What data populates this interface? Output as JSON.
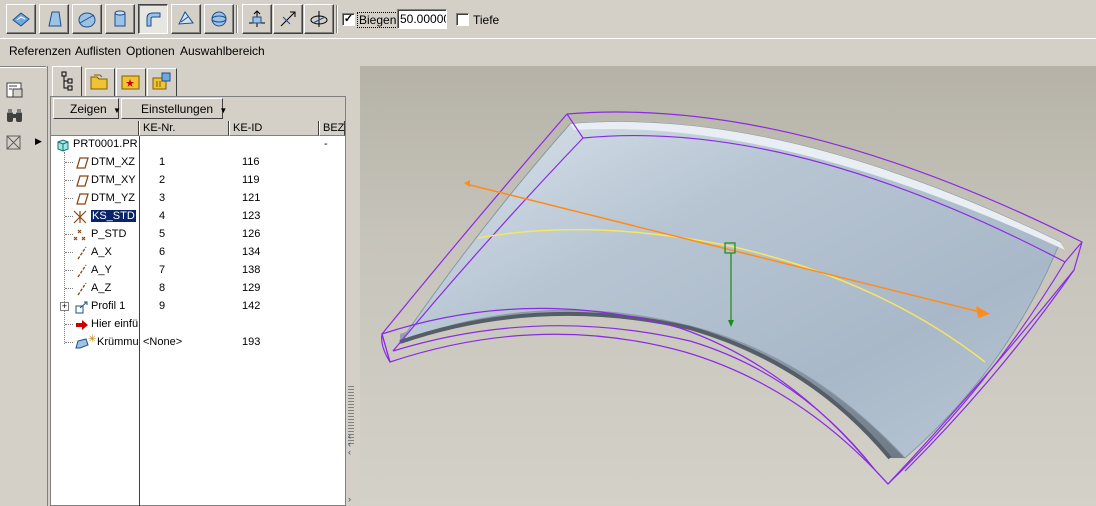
{
  "toolbar": {
    "buttons": [
      {
        "name": "surface-icon"
      },
      {
        "name": "solid-icon"
      },
      {
        "name": "thicken-icon"
      },
      {
        "name": "cylinder-icon"
      },
      {
        "name": "sweep-icon",
        "pressed": true
      },
      {
        "name": "warp-icon"
      },
      {
        "name": "sphere-icon"
      }
    ],
    "buttons2": [
      {
        "name": "move-axis-icon"
      },
      {
        "name": "diagonal-icon"
      },
      {
        "name": "rotate-axis-icon"
      }
    ],
    "biegen_checked": true,
    "biegen_label": "Biegen",
    "biegen_value": "50.00000",
    "tiefe_checked": false,
    "tiefe_label": "Tiefe"
  },
  "menu": [
    "Referenzen",
    "Auflisten",
    "Optionen",
    "Auswahlbereich"
  ],
  "tree": {
    "zeigen_label": "Zeigen",
    "einstellungen_label": "Einstellungen",
    "columns": [
      "KE-Nr.",
      "KE-ID",
      "BEZ"
    ],
    "root": {
      "name": "PRT0001.PR",
      "bez": "-"
    },
    "items": [
      {
        "name": "DTM_XZ",
        "nr": "1",
        "id": "116",
        "icon": "datum-plane-icon"
      },
      {
        "name": "DTM_XY",
        "nr": "2",
        "id": "119",
        "icon": "datum-plane-icon"
      },
      {
        "name": "DTM_YZ",
        "nr": "3",
        "id": "121",
        "icon": "datum-plane-icon"
      },
      {
        "name": "KS_STD",
        "nr": "4",
        "id": "123",
        "icon": "coordinate-system-icon",
        "selected": true
      },
      {
        "name": "P_STD",
        "nr": "5",
        "id": "126",
        "icon": "datum-point-icon"
      },
      {
        "name": "A_X",
        "nr": "6",
        "id": "134",
        "icon": "datum-axis-icon"
      },
      {
        "name": "A_Y",
        "nr": "7",
        "id": "138",
        "icon": "datum-axis-icon"
      },
      {
        "name": "A_Z",
        "nr": "8",
        "id": "129",
        "icon": "datum-axis-icon"
      },
      {
        "name": "Profil 1",
        "nr": "9",
        "id": "142",
        "icon": "profile-icon",
        "expandable": true
      },
      {
        "name": "Hier einfü",
        "nr": "",
        "id": "",
        "icon": "insert-here-arrow-icon"
      },
      {
        "name": "Krümmu",
        "nr": "<None>",
        "id": "193",
        "icon": "bend-feature-icon"
      }
    ]
  }
}
